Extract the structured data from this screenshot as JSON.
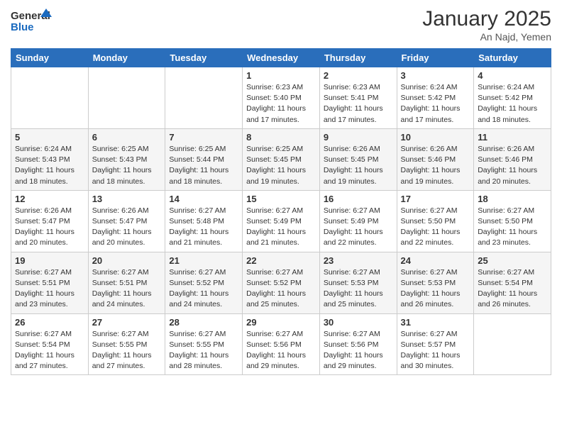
{
  "header": {
    "logo_line1": "General",
    "logo_line2": "Blue",
    "title": "January 2025",
    "location": "An Najd, Yemen"
  },
  "weekdays": [
    "Sunday",
    "Monday",
    "Tuesday",
    "Wednesday",
    "Thursday",
    "Friday",
    "Saturday"
  ],
  "weeks": [
    [
      {
        "day": "",
        "info": ""
      },
      {
        "day": "",
        "info": ""
      },
      {
        "day": "",
        "info": ""
      },
      {
        "day": "1",
        "info": "Sunrise: 6:23 AM\nSunset: 5:40 PM\nDaylight: 11 hours and 17 minutes."
      },
      {
        "day": "2",
        "info": "Sunrise: 6:23 AM\nSunset: 5:41 PM\nDaylight: 11 hours and 17 minutes."
      },
      {
        "day": "3",
        "info": "Sunrise: 6:24 AM\nSunset: 5:42 PM\nDaylight: 11 hours and 17 minutes."
      },
      {
        "day": "4",
        "info": "Sunrise: 6:24 AM\nSunset: 5:42 PM\nDaylight: 11 hours and 18 minutes."
      }
    ],
    [
      {
        "day": "5",
        "info": "Sunrise: 6:24 AM\nSunset: 5:43 PM\nDaylight: 11 hours and 18 minutes."
      },
      {
        "day": "6",
        "info": "Sunrise: 6:25 AM\nSunset: 5:43 PM\nDaylight: 11 hours and 18 minutes."
      },
      {
        "day": "7",
        "info": "Sunrise: 6:25 AM\nSunset: 5:44 PM\nDaylight: 11 hours and 18 minutes."
      },
      {
        "day": "8",
        "info": "Sunrise: 6:25 AM\nSunset: 5:45 PM\nDaylight: 11 hours and 19 minutes."
      },
      {
        "day": "9",
        "info": "Sunrise: 6:26 AM\nSunset: 5:45 PM\nDaylight: 11 hours and 19 minutes."
      },
      {
        "day": "10",
        "info": "Sunrise: 6:26 AM\nSunset: 5:46 PM\nDaylight: 11 hours and 19 minutes."
      },
      {
        "day": "11",
        "info": "Sunrise: 6:26 AM\nSunset: 5:46 PM\nDaylight: 11 hours and 20 minutes."
      }
    ],
    [
      {
        "day": "12",
        "info": "Sunrise: 6:26 AM\nSunset: 5:47 PM\nDaylight: 11 hours and 20 minutes."
      },
      {
        "day": "13",
        "info": "Sunrise: 6:26 AM\nSunset: 5:47 PM\nDaylight: 11 hours and 20 minutes."
      },
      {
        "day": "14",
        "info": "Sunrise: 6:27 AM\nSunset: 5:48 PM\nDaylight: 11 hours and 21 minutes."
      },
      {
        "day": "15",
        "info": "Sunrise: 6:27 AM\nSunset: 5:49 PM\nDaylight: 11 hours and 21 minutes."
      },
      {
        "day": "16",
        "info": "Sunrise: 6:27 AM\nSunset: 5:49 PM\nDaylight: 11 hours and 22 minutes."
      },
      {
        "day": "17",
        "info": "Sunrise: 6:27 AM\nSunset: 5:50 PM\nDaylight: 11 hours and 22 minutes."
      },
      {
        "day": "18",
        "info": "Sunrise: 6:27 AM\nSunset: 5:50 PM\nDaylight: 11 hours and 23 minutes."
      }
    ],
    [
      {
        "day": "19",
        "info": "Sunrise: 6:27 AM\nSunset: 5:51 PM\nDaylight: 11 hours and 23 minutes."
      },
      {
        "day": "20",
        "info": "Sunrise: 6:27 AM\nSunset: 5:51 PM\nDaylight: 11 hours and 24 minutes."
      },
      {
        "day": "21",
        "info": "Sunrise: 6:27 AM\nSunset: 5:52 PM\nDaylight: 11 hours and 24 minutes."
      },
      {
        "day": "22",
        "info": "Sunrise: 6:27 AM\nSunset: 5:52 PM\nDaylight: 11 hours and 25 minutes."
      },
      {
        "day": "23",
        "info": "Sunrise: 6:27 AM\nSunset: 5:53 PM\nDaylight: 11 hours and 25 minutes."
      },
      {
        "day": "24",
        "info": "Sunrise: 6:27 AM\nSunset: 5:53 PM\nDaylight: 11 hours and 26 minutes."
      },
      {
        "day": "25",
        "info": "Sunrise: 6:27 AM\nSunset: 5:54 PM\nDaylight: 11 hours and 26 minutes."
      }
    ],
    [
      {
        "day": "26",
        "info": "Sunrise: 6:27 AM\nSunset: 5:54 PM\nDaylight: 11 hours and 27 minutes."
      },
      {
        "day": "27",
        "info": "Sunrise: 6:27 AM\nSunset: 5:55 PM\nDaylight: 11 hours and 27 minutes."
      },
      {
        "day": "28",
        "info": "Sunrise: 6:27 AM\nSunset: 5:55 PM\nDaylight: 11 hours and 28 minutes."
      },
      {
        "day": "29",
        "info": "Sunrise: 6:27 AM\nSunset: 5:56 PM\nDaylight: 11 hours and 29 minutes."
      },
      {
        "day": "30",
        "info": "Sunrise: 6:27 AM\nSunset: 5:56 PM\nDaylight: 11 hours and 29 minutes."
      },
      {
        "day": "31",
        "info": "Sunrise: 6:27 AM\nSunset: 5:57 PM\nDaylight: 11 hours and 30 minutes."
      },
      {
        "day": "",
        "info": ""
      }
    ]
  ]
}
